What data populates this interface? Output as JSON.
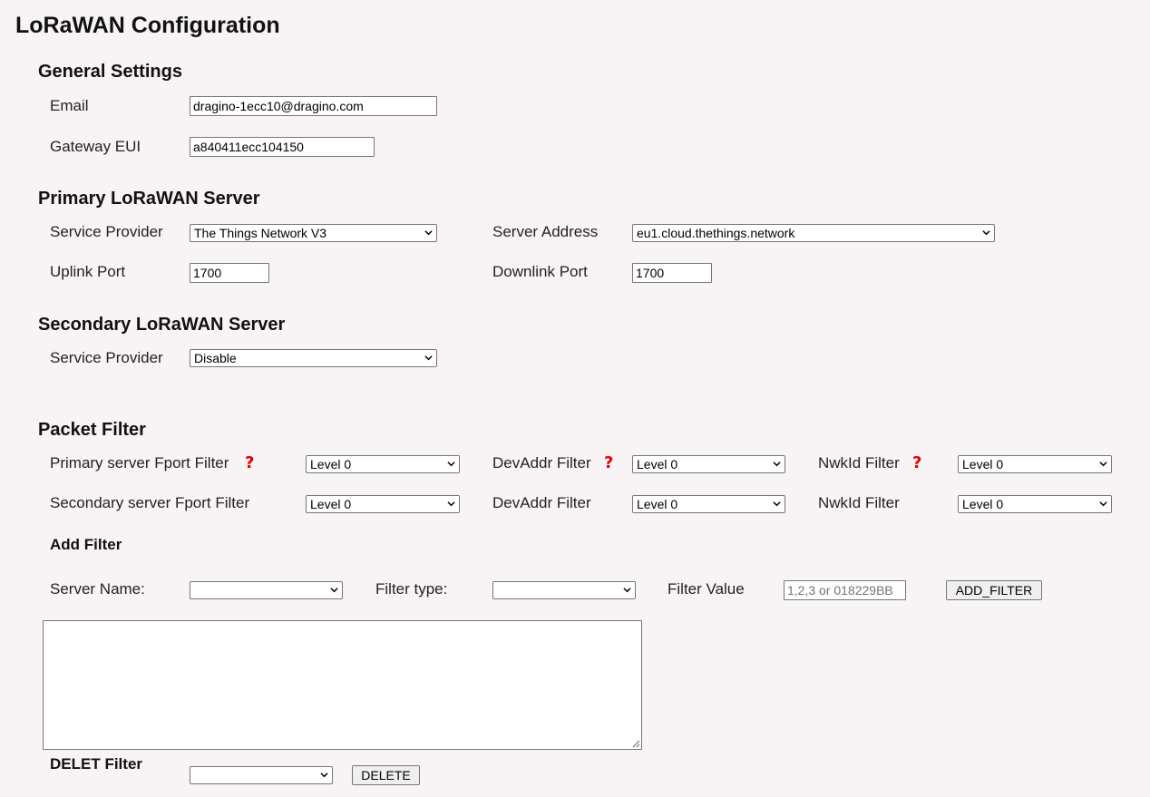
{
  "page": {
    "title": "LoRaWAN Configuration"
  },
  "general": {
    "heading": "General Settings",
    "email_label": "Email",
    "email_value": "dragino-1ecc10@dragino.com",
    "eui_label": "Gateway EUI",
    "eui_value": "a840411ecc104150"
  },
  "primary": {
    "heading": "Primary LoRaWAN Server",
    "provider_label": "Service Provider",
    "provider_value": "The Things Network V3",
    "address_label": "Server Address",
    "address_value": "eu1.cloud.thethings.network",
    "uplink_label": "Uplink Port",
    "uplink_value": "1700",
    "downlink_label": "Downlink Port",
    "downlink_value": "1700"
  },
  "secondary": {
    "heading": "Secondary LoRaWAN Server",
    "provider_label": "Service Provider",
    "provider_value": "Disable"
  },
  "filter": {
    "heading": "Packet Filter",
    "help_glyph": "?",
    "primary_fport_label": "Primary server Fport Filter",
    "primary_fport_value": "Level 0",
    "primary_devaddr_label": "DevAddr Filter",
    "primary_devaddr_value": "Level 0",
    "primary_nwkid_label": "NwkId Filter",
    "primary_nwkid_value": "Level 0",
    "secondary_fport_label": "Secondary server Fport Filter",
    "secondary_fport_value": "Level 0",
    "secondary_devaddr_label": "DevAddr Filter",
    "secondary_devaddr_value": "Level 0",
    "secondary_nwkid_label": "NwkId Filter",
    "secondary_nwkid_value": "Level 0",
    "add_heading": "Add Filter",
    "server_name_label": "Server Name:",
    "server_name_value": "",
    "filter_type_label": "Filter type:",
    "filter_type_value": "",
    "filter_value_label": "Filter Value",
    "filter_value_placeholder": "1,2,3 or 018229BB",
    "add_button": "ADD_FILTER",
    "delete_heading": "DELET Filter",
    "delete_value": "",
    "delete_button": "DELETE"
  },
  "colors": {
    "background": "#f8f4f5",
    "help_icon": "#e00000"
  }
}
